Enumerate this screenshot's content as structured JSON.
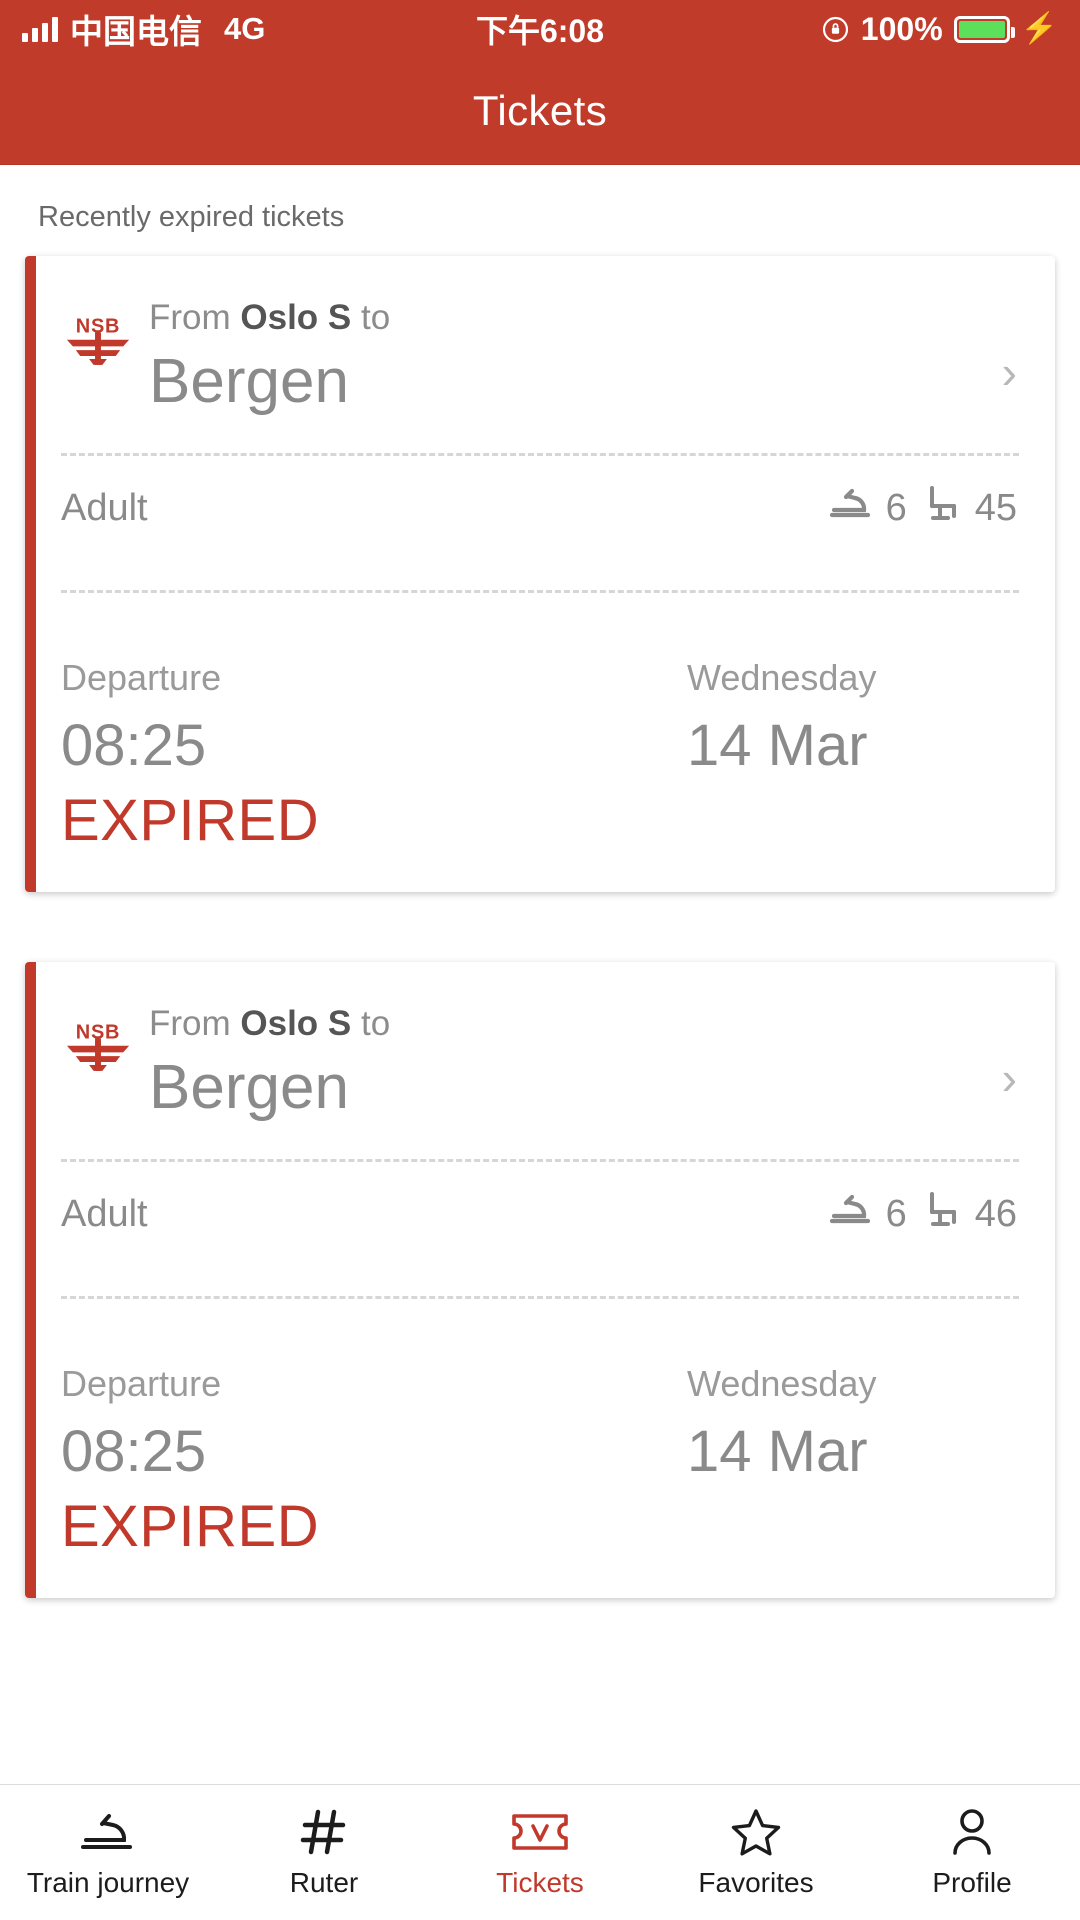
{
  "statusbar": {
    "carrier": "中国电信",
    "network": "4G",
    "time": "下午6:08",
    "battery_percent": "100%",
    "signal_icon": "signal-bars-icon",
    "lock_icon": "rotation-lock-icon",
    "battery_icon": "battery-icon",
    "charging_icon": "lightning-bolt-icon"
  },
  "header": {
    "title": "Tickets",
    "background_color": "#C13B2A"
  },
  "main": {
    "section_label": "Recently expired tickets",
    "accent_color": "#C0392B",
    "tickets": [
      {
        "operator_logo": "nsb-logo",
        "from_prefix": "From",
        "from_station": "Oslo S",
        "to_prefix": "to",
        "to_station": "Bergen",
        "chevron_icon": "chevron-right-icon",
        "passenger_type": "Adult",
        "car_icon": "train-icon",
        "car_number": "6",
        "seat_icon": "seat-icon",
        "seat_number": "45",
        "departure_label": "Departure",
        "departure_time": "08:25",
        "day_label": "Wednesday",
        "date": "14 Mar",
        "status": "EXPIRED"
      },
      {
        "operator_logo": "nsb-logo",
        "from_prefix": "From",
        "from_station": "Oslo S",
        "to_prefix": "to",
        "to_station": "Bergen",
        "chevron_icon": "chevron-right-icon",
        "passenger_type": "Adult",
        "car_icon": "train-icon",
        "car_number": "6",
        "seat_icon": "seat-icon",
        "seat_number": "46",
        "departure_label": "Departure",
        "departure_time": "08:25",
        "day_label": "Wednesday",
        "date": "14 Mar",
        "status": "EXPIRED"
      }
    ]
  },
  "tabbar": {
    "active_index": 2,
    "items": [
      {
        "label": "Train journey",
        "icon": "train-icon"
      },
      {
        "label": "Ruter",
        "icon": "hash-icon"
      },
      {
        "label": "Tickets",
        "icon": "ticket-check-icon"
      },
      {
        "label": "Favorites",
        "icon": "star-icon"
      },
      {
        "label": "Profile",
        "icon": "person-icon"
      }
    ]
  }
}
